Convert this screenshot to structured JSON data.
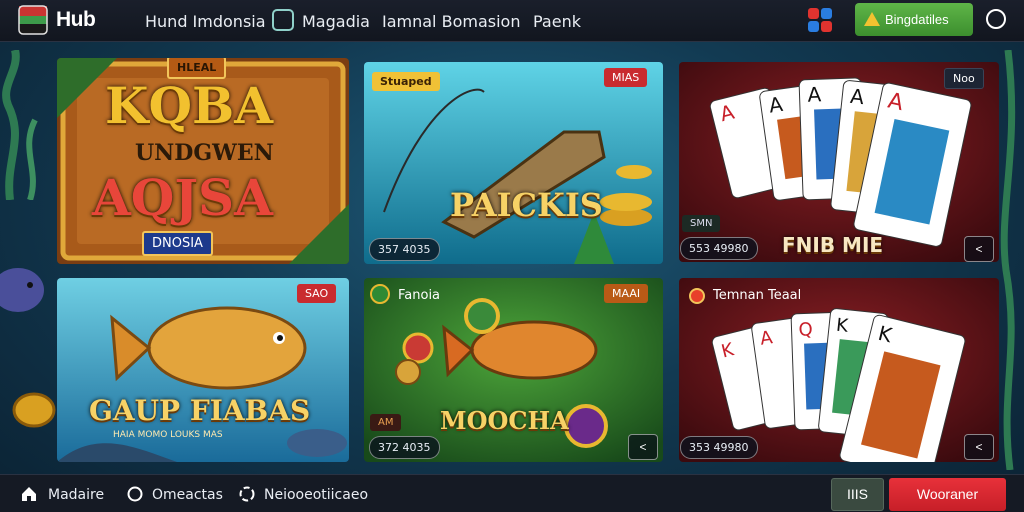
{
  "header": {
    "app_title": "Hub",
    "nav": [
      "Hund Imdonsia",
      "Magadia",
      "Iamnal Bomasion",
      "Paenk"
    ],
    "promo_label": "Bingdatiles"
  },
  "cards": [
    {
      "badge": "HLEAL",
      "title_line1": "KQBA",
      "title_line2": "UNDGWEN",
      "title_line3": "AQJSA",
      "subtitle": "DNOSIA"
    },
    {
      "badge_left": "Stuaped",
      "badge": "MIAS",
      "title": "PAICKIS",
      "stat": "357 4035"
    },
    {
      "badge": "Noo",
      "badge_left": "SMN",
      "title": "FNIB MIE",
      "stat": "553 49980",
      "corner": "<"
    },
    {
      "badge": "SAO",
      "title": "GAUP FIABAS",
      "subtitle": "HAIA MOMO LOUKS MAS"
    },
    {
      "label": "Fanoia",
      "badge": "MAAI",
      "badge_left": "AM",
      "title": "MOOCHA",
      "stat": "372 4035",
      "corner": "<"
    },
    {
      "label": "Temnan Teaal",
      "stat": "353 49980",
      "corner": "<"
    }
  ],
  "footer": {
    "nav": [
      "Madaire",
      "Omeactas",
      "Neiooeotiicaeo"
    ],
    "secondary_button": "IIIS",
    "primary_button": "Wooraner"
  },
  "colors": {
    "accent_green": "#4caa3a",
    "accent_red": "#d8262f",
    "gold": "#f7d266"
  }
}
